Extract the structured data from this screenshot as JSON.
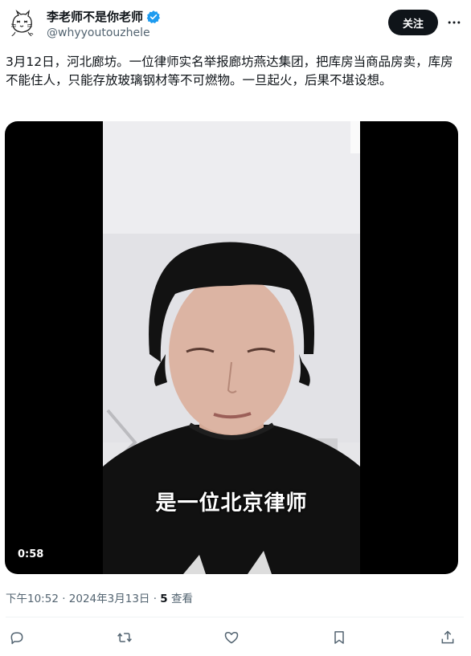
{
  "author": {
    "display_name": "李老师不是你老师",
    "handle": "@whyyoutouzhele",
    "avatar_icon": "cat-doodle-avatar",
    "verified_icon": "verified-badge-icon",
    "verified_color": "#1d9bf0"
  },
  "header": {
    "follow_label": "关注",
    "more_icon": "more-options-icon"
  },
  "tweet": {
    "text": "3月12日，河北廊坊。一位律师实名举报廊坊燕达集团，把库房当商品房卖，库房不能住人，只能存放玻璃钢材等不可燃物。一旦起火，后果不堪设想。"
  },
  "media": {
    "type": "video",
    "subtitle": "是一位北京律师",
    "duration": "0:58"
  },
  "meta": {
    "time": "下午10:52",
    "separator": " · ",
    "date": "2024年3月13日",
    "views_count": "5",
    "views_label": " 查看"
  },
  "actions": {
    "reply_icon": "reply-icon",
    "retweet_icon": "retweet-icon",
    "like_icon": "like-icon",
    "bookmark_icon": "bookmark-icon",
    "share_icon": "share-icon"
  },
  "colors": {
    "text_primary": "#0f1419",
    "text_secondary": "#536471",
    "follow_bg": "#0f1419",
    "media_bg": "#000000"
  }
}
